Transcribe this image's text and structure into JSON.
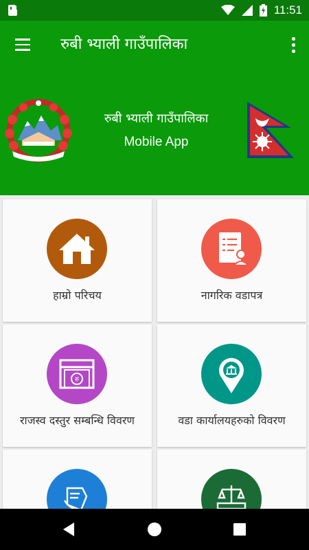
{
  "status_bar": {
    "time": "11:51",
    "icons": [
      "sd-card-icon",
      "wifi-icon",
      "signal-icon",
      "battery-charging-icon"
    ]
  },
  "app_bar": {
    "title": "रुबी भ्याली गाउँपालिका",
    "menu_icon": "hamburger-menu-icon",
    "overflow_icon": "more-vert-icon"
  },
  "banner": {
    "title": "रुबी भ्याली गाउँपालिका",
    "subtitle": "Mobile App",
    "left_image": "nepal-government-emblem",
    "right_image": "nepal-flag"
  },
  "menu_items": [
    {
      "label": "हाम्रो परिचय",
      "icon": "home-icon",
      "color": "#b25a0b"
    },
    {
      "label": "नागरिक वडापत्र",
      "icon": "citizen-charter-icon",
      "color": "#f05a4a"
    },
    {
      "label": "राजस्व दस्तुर सम्बन्धि विवरण",
      "icon": "revenue-icon",
      "color": "#b347c6"
    },
    {
      "label": "वडा कार्यालयहरुको विवरण",
      "icon": "ward-office-location-icon",
      "color": "#009688"
    },
    {
      "label": "",
      "icon": "document-hand-icon",
      "color": "#1e7fd6"
    },
    {
      "label": "",
      "icon": "justice-scale-icon",
      "color": "#1a6b35"
    }
  ],
  "colors": {
    "status_bar": "#0a7a0a",
    "app_bar": "#0a9a0a",
    "background": "#ececec"
  },
  "nav_bar": {
    "icons": [
      "back-icon",
      "home-circle-icon",
      "recents-icon"
    ]
  }
}
